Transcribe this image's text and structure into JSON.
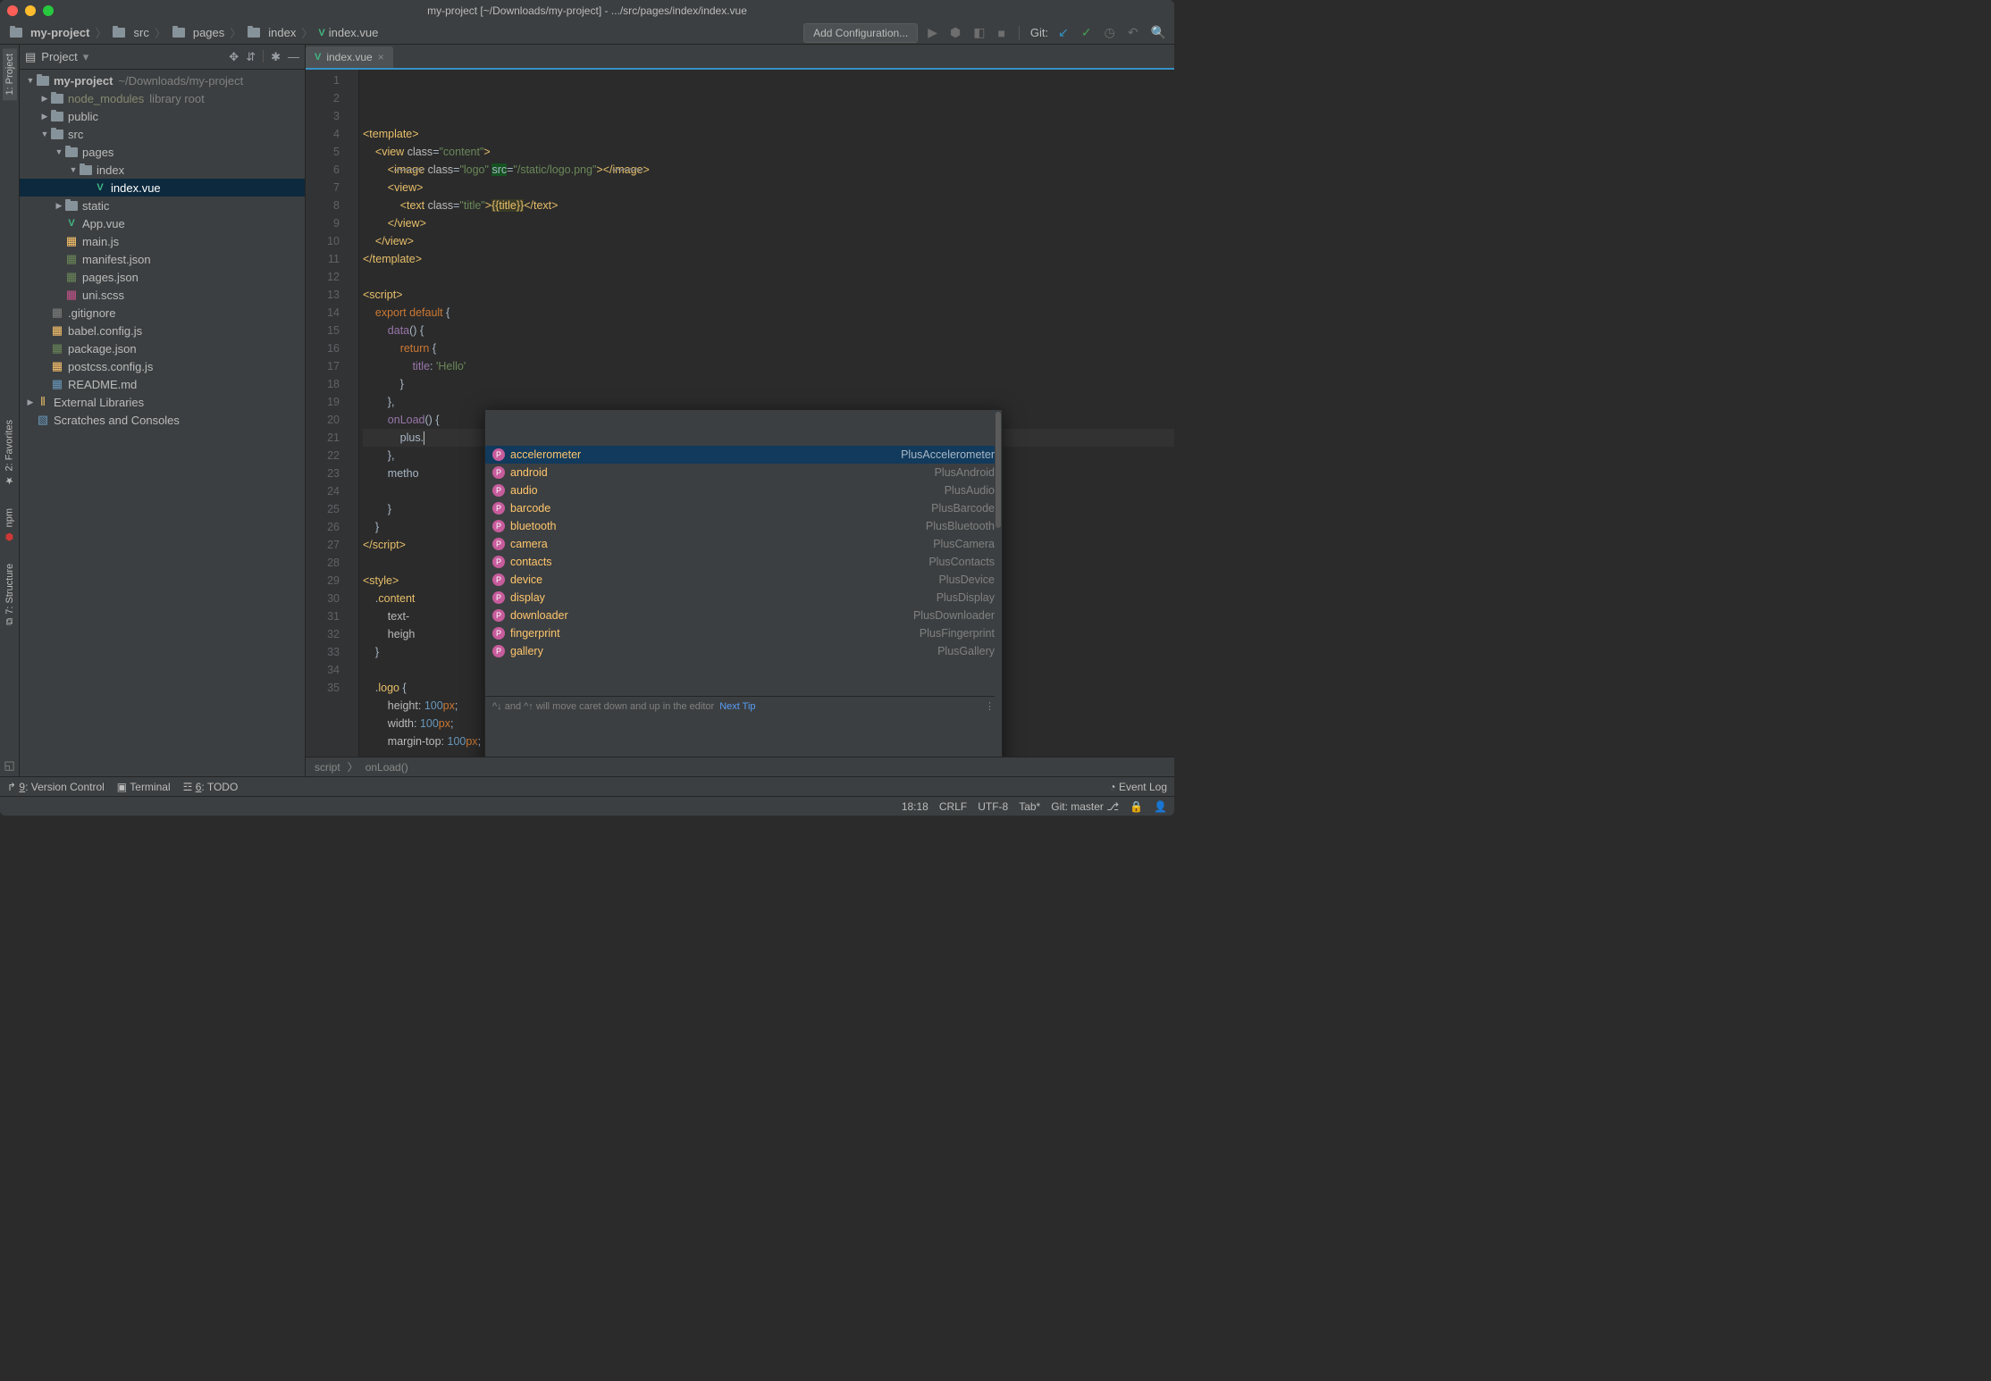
{
  "window_title": "my-project [~/Downloads/my-project] - .../src/pages/index/index.vue",
  "breadcrumbs": [
    "my-project",
    "src",
    "pages",
    "index",
    "index.vue"
  ],
  "add_config": "Add Configuration...",
  "git_label": "Git:",
  "sidebar_tabs": {
    "project": "1: Project",
    "favorites": "2: Favorites",
    "npm": "npm",
    "structure": "7: Structure"
  },
  "project_panel": {
    "title": "Project"
  },
  "tree": {
    "root": "my-project",
    "root_hint": "~/Downloads/my-project",
    "nodes": [
      {
        "ind": 1,
        "arrow": "▶",
        "name": "node_modules",
        "hint": "library root",
        "dim": true
      },
      {
        "ind": 1,
        "arrow": "▶",
        "name": "public"
      },
      {
        "ind": 1,
        "arrow": "▼",
        "name": "src"
      },
      {
        "ind": 2,
        "arrow": "▼",
        "name": "pages"
      },
      {
        "ind": 3,
        "arrow": "▼",
        "name": "index"
      },
      {
        "ind": 4,
        "icon": "vue",
        "name": "index.vue",
        "sel": true
      },
      {
        "ind": 2,
        "arrow": "▶",
        "name": "static"
      },
      {
        "ind": 2,
        "icon": "vue",
        "name": "App.vue"
      },
      {
        "ind": 2,
        "icon": "js",
        "name": "main.js"
      },
      {
        "ind": 2,
        "icon": "json",
        "name": "manifest.json"
      },
      {
        "ind": 2,
        "icon": "json",
        "name": "pages.json"
      },
      {
        "ind": 2,
        "icon": "scss",
        "name": "uni.scss"
      },
      {
        "ind": 1,
        "icon": "git",
        "name": ".gitignore"
      },
      {
        "ind": 1,
        "icon": "js",
        "name": "babel.config.js"
      },
      {
        "ind": 1,
        "icon": "json",
        "name": "package.json"
      },
      {
        "ind": 1,
        "icon": "js",
        "name": "postcss.config.js"
      },
      {
        "ind": 1,
        "icon": "md",
        "name": "README.md"
      }
    ],
    "ext_lib": "External Libraries",
    "scratches": "Scratches and Consoles"
  },
  "tab_name": "index.vue",
  "code_lines": [
    {
      "n": 1,
      "html": "<span class='tag-o'>&lt;template&gt;</span>"
    },
    {
      "n": 2,
      "html": "    <span class='tag-o'>&lt;view</span> <span class='attr'>class</span>=<span class='str'>\"content\"</span><span class='tag-o'>&gt;</span>"
    },
    {
      "n": 3,
      "html": "        <span class='tag-o'>&lt;<span class='strike'>image</span></span> <span class='attr'>class</span>=<span class='str'>\"logo\"</span> <span class='highlight-src'>src</span>=<span class='str'>\"/static/logo.png\"</span><span class='tag-o'>&gt;&lt;/<span class='strike'>image</span>&gt;</span>"
    },
    {
      "n": 4,
      "html": "        <span class='tag-o'>&lt;view&gt;</span>"
    },
    {
      "n": 5,
      "html": "            <span class='tag-o'>&lt;text</span> <span class='attr'>class</span>=<span class='str'>\"title\"</span><span class='tag-o'>&gt;</span><span class='mustache'>{{title}}</span><span class='tag-o'>&lt;/text&gt;</span>"
    },
    {
      "n": 6,
      "html": "        <span class='tag-o'>&lt;/view&gt;</span>"
    },
    {
      "n": 7,
      "html": "    <span class='tag-o'>&lt;/view&gt;</span>"
    },
    {
      "n": 8,
      "html": "<span class='tag-o'>&lt;/template&gt;</span>"
    },
    {
      "n": 9,
      "html": ""
    },
    {
      "n": 10,
      "html": "<span class='tag-o'>&lt;script&gt;</span>"
    },
    {
      "n": 11,
      "html": "    <span class='kw'>export default </span>{"
    },
    {
      "n": 12,
      "html": "        <span class='pp'>data</span>() {"
    },
    {
      "n": 13,
      "html": "            <span class='kw'>return </span>{"
    },
    {
      "n": 14,
      "html": "                <span class='pp'>title</span>: <span class='str'>'Hello'</span>"
    },
    {
      "n": 15,
      "html": "            }"
    },
    {
      "n": 16,
      "html": "        },"
    },
    {
      "n": 17,
      "html": "        <span class='pp'>onLoad</span>() {"
    },
    {
      "n": 18,
      "hl": true,
      "html": "            plus.<span class='caret'></span>"
    },
    {
      "n": 19,
      "html": "        },"
    },
    {
      "n": 20,
      "html": "        metho"
    },
    {
      "n": 21,
      "html": ""
    },
    {
      "n": 22,
      "html": "        }"
    },
    {
      "n": 23,
      "html": "    }"
    },
    {
      "n": 24,
      "html": "<span class='tag-o'>&lt;/script&gt;</span>"
    },
    {
      "n": 25,
      "html": ""
    },
    {
      "n": 26,
      "html": "<span class='tag-o'>&lt;style&gt;</span>"
    },
    {
      "n": 27,
      "html": "    .<span class='tag-o'>content </span>"
    },
    {
      "n": 28,
      "html": "        <span class='attr'>text-</span>"
    },
    {
      "n": 29,
      "html": "        <span class='attr'>heigh</span>"
    },
    {
      "n": 30,
      "html": "    }"
    },
    {
      "n": 31,
      "html": ""
    },
    {
      "n": 32,
      "html": "    .<span class='tag-o'>logo </span>{"
    },
    {
      "n": 33,
      "html": "        <span class='attr'>height</span>: <span class='num'>100</span><span class='kw'>px</span>;"
    },
    {
      "n": 34,
      "html": "        <span class='attr'>width</span>: <span class='num'>100</span><span class='kw'>px</span>;"
    },
    {
      "n": 35,
      "html": "        <span class='attr'>margin-top</span>: <span class='num'>100</span><span class='kw'>px</span>;"
    }
  ],
  "popup": {
    "items": [
      {
        "label": "accelerometer",
        "type": "PlusAccelerometer",
        "sel": true
      },
      {
        "label": "android",
        "type": "PlusAndroid"
      },
      {
        "label": "audio",
        "type": "PlusAudio"
      },
      {
        "label": "barcode",
        "type": "PlusBarcode"
      },
      {
        "label": "bluetooth",
        "type": "PlusBluetooth"
      },
      {
        "label": "camera",
        "type": "PlusCamera"
      },
      {
        "label": "contacts",
        "type": "PlusContacts"
      },
      {
        "label": "device",
        "type": "PlusDevice"
      },
      {
        "label": "display",
        "type": "PlusDisplay"
      },
      {
        "label": "downloader",
        "type": "PlusDownloader"
      },
      {
        "label": "fingerprint",
        "type": "PlusFingerprint"
      },
      {
        "label": "gallery",
        "type": "PlusGallery"
      }
    ],
    "foot_text": "^↓ and ^↑ will move caret down and up in the editor",
    "next_tip": "Next Tip"
  },
  "crumb_bar": [
    "script",
    "onLoad()"
  ],
  "bottom_tools": {
    "vc": "9: Version Control",
    "term": "Terminal",
    "todo": "6: TODO",
    "log": "Event Log"
  },
  "status": {
    "pos": "18:18",
    "le": "CRLF",
    "enc": "UTF-8",
    "indent": "Tab*",
    "branch": "Git: master"
  }
}
